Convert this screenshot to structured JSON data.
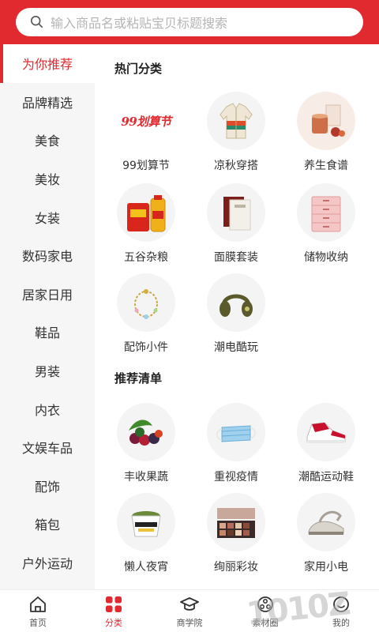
{
  "colors": {
    "accent": "#e02a2f",
    "sidebar_bg": "#f6f6f6"
  },
  "search": {
    "placeholder": "输入商品名或粘贴宝贝标题搜索",
    "icon": "search-icon"
  },
  "sidebar": {
    "items": [
      {
        "label": "为你推荐",
        "active": true
      },
      {
        "label": "品牌精选"
      },
      {
        "label": "美食"
      },
      {
        "label": "美妆"
      },
      {
        "label": "女装"
      },
      {
        "label": "数码家电"
      },
      {
        "label": "居家日用"
      },
      {
        "label": "鞋品"
      },
      {
        "label": "男装"
      },
      {
        "label": "内衣"
      },
      {
        "label": "文娱车品"
      },
      {
        "label": "配饰"
      },
      {
        "label": "箱包"
      },
      {
        "label": "户外运动"
      }
    ]
  },
  "hot": {
    "title": "热门分类",
    "items": [
      {
        "label": "99划算节",
        "logo_text": "99划算节"
      },
      {
        "label": "凉秋穿搭"
      },
      {
        "label": "养生食谱"
      },
      {
        "label": "五谷杂粮"
      },
      {
        "label": "面膜套装"
      },
      {
        "label": "储物收纳"
      },
      {
        "label": "配饰小件"
      },
      {
        "label": "潮电酷玩"
      }
    ]
  },
  "recommend": {
    "title": "推荐清单",
    "items": [
      {
        "label": "丰收果蔬"
      },
      {
        "label": "重视疫情"
      },
      {
        "label": "潮酷运动鞋"
      },
      {
        "label": "懒人夜宵"
      },
      {
        "label": "绚丽彩妆"
      },
      {
        "label": "家用小电"
      }
    ]
  },
  "tabbar": {
    "tabs": [
      {
        "label": "首页",
        "icon": "home-icon"
      },
      {
        "label": "分类",
        "icon": "category-icon",
        "active": true
      },
      {
        "label": "商学院",
        "icon": "graduation-cap-icon"
      },
      {
        "label": "素材圈",
        "icon": "material-circle-icon"
      },
      {
        "label": "我的",
        "icon": "profile-icon"
      }
    ]
  },
  "watermark": {
    "text": "1010Z"
  }
}
